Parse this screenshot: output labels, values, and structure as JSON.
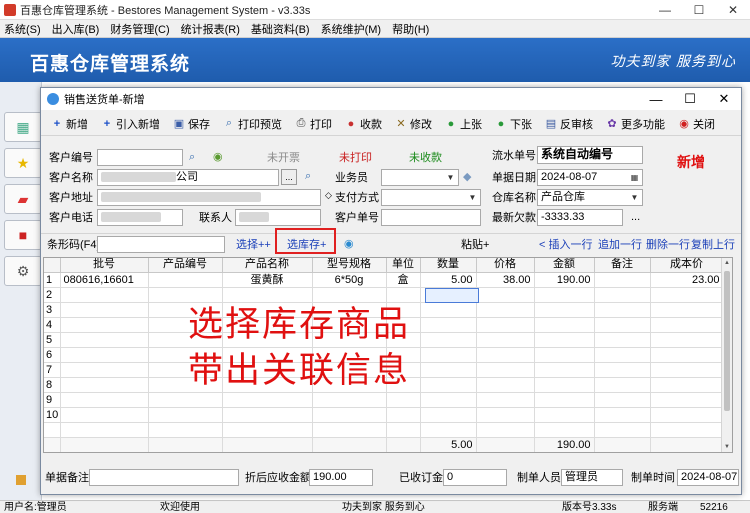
{
  "app": {
    "title": "百惠仓库管理系统 - Bestores Management System - v3.33s",
    "menu": [
      "系统(S)",
      "出入库(B)",
      "财务管理(C)",
      "统计报表(R)",
      "基础资料(B)",
      "系统维护(M)",
      "帮助(H)"
    ],
    "brand": "百惠仓库管理系统",
    "slogan": "功夫到家  服务到心"
  },
  "statusbar": {
    "user": "用户名:管理员",
    "welcome": "欢迎使用",
    "motto": "功夫到家 服务到心",
    "version": "版本号3.33s",
    "server": "服务端",
    "port": "52216"
  },
  "dialog": {
    "title": "销售送货单-新增",
    "status_tag": "新增",
    "toolbar": {
      "new": "新增",
      "import_new": "引入新增",
      "save": "保存",
      "print_preview": "打印预览",
      "print": "打印",
      "collect": "收款",
      "modify": "修改",
      "prev": "上张",
      "next": "下张",
      "unreview": "反审核",
      "more": "更多功能",
      "close": "关闭"
    },
    "form": {
      "customer_no_label": "客户编号",
      "customer_no_value": "",
      "status_invoice": "未开票",
      "status_print": "未打印",
      "status_payment": "未收款",
      "serial_label": "流水单号",
      "serial_value": "系统自动编号",
      "customer_name_label": "客户名称",
      "customer_name_suffix": "公司",
      "ellipsis": "...",
      "salesman_label": "业务员",
      "salesman_value": "",
      "date_label": "单据日期",
      "date_value": "2024-08-07",
      "address_label": "客户地址",
      "payment_label": "支付方式",
      "payment_value": "",
      "warehouse_label": "仓库名称",
      "warehouse_value": "产品仓库",
      "phone_label": "客户电话",
      "contact_label": "联系人",
      "customer_order_label": "客户单号",
      "customer_order_value": "",
      "latest_debt_label": "最新欠款",
      "latest_debt_value": "-3333.33"
    },
    "barcode": {
      "label": "条形码(F4)",
      "value": "",
      "select_plus": "选择++",
      "select_stock": "选库存+",
      "paste": "粘贴+",
      "insert_row": "< 插入一行",
      "append_row": "追加一行",
      "delete_row": "删除一行",
      "copy_row": "复制上行"
    },
    "grid": {
      "headers": [
        "",
        "批号",
        "产品编号",
        "产品名称",
        "型号规格",
        "单位",
        "数量",
        "价格",
        "金额",
        "备注",
        "成本价"
      ],
      "rows": [
        [
          "1",
          "080616,16601",
          "",
          "蛋黄酥",
          "6*50g",
          "盒",
          "5.00",
          "38.00",
          "190.00",
          "",
          "23.00"
        ],
        [
          "2",
          "",
          "",
          "",
          "",
          "",
          "",
          "",
          "",
          "",
          ""
        ],
        [
          "3",
          "",
          "",
          "",
          "",
          "",
          "",
          "",
          "",
          "",
          ""
        ],
        [
          "4",
          "",
          "",
          "",
          "",
          "",
          "",
          "",
          "",
          "",
          ""
        ],
        [
          "5",
          "",
          "",
          "",
          "",
          "",
          "",
          "",
          "",
          "",
          ""
        ],
        [
          "6",
          "",
          "",
          "",
          "",
          "",
          "",
          "",
          "",
          "",
          ""
        ],
        [
          "7",
          "",
          "",
          "",
          "",
          "",
          "",
          "",
          "",
          "",
          ""
        ],
        [
          "8",
          "",
          "",
          "",
          "",
          "",
          "",
          "",
          "",
          "",
          ""
        ],
        [
          "9",
          "",
          "",
          "",
          "",
          "",
          "",
          "",
          "",
          "",
          ""
        ],
        [
          "10",
          "",
          "",
          "",
          "",
          "",
          "",
          "",
          "",
          "",
          ""
        ]
      ],
      "total_qty": "5.00",
      "total_amount": "190.00"
    },
    "annotation": {
      "line1": "选择库存商品",
      "line2": "带出关联信息"
    },
    "footer": {
      "remark_label": "单据备注",
      "remark_value": "",
      "discount_label": "折后应收金额",
      "discount_value": "190.00",
      "deposit_label": "已收订金",
      "deposit_value": "0",
      "maker_label": "制单人员",
      "maker_value": "管理员",
      "make_time_label": "制单时间",
      "make_time_value": "2024-08-07"
    }
  }
}
